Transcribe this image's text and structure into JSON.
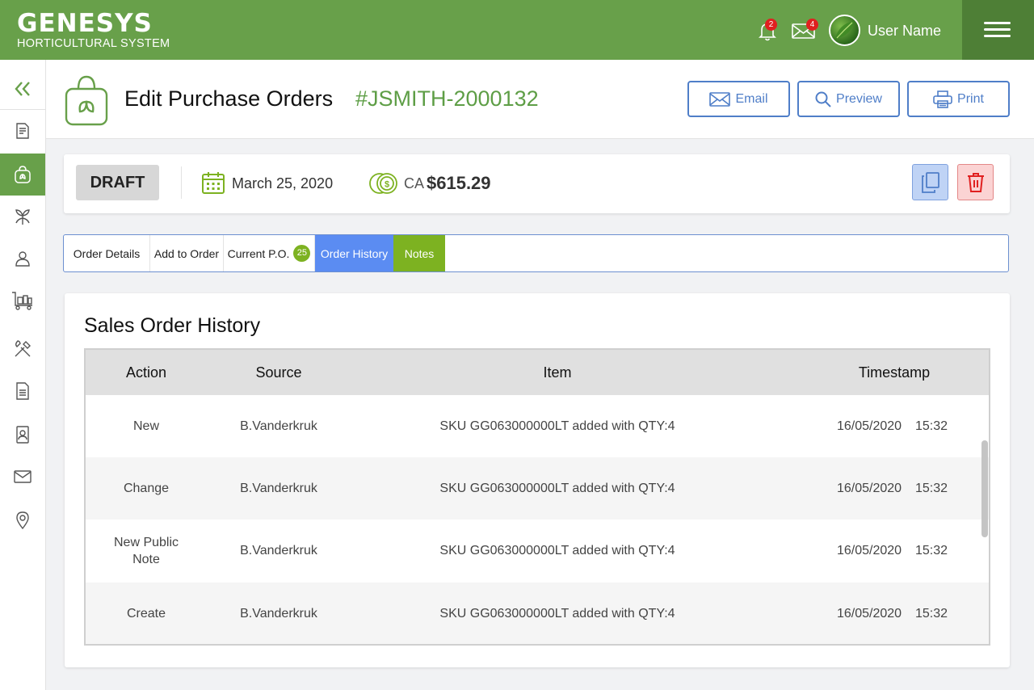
{
  "brand": {
    "name": "GENESYS",
    "subtitle": "HORTICULTURAL SYSTEM",
    "color": "#68a04a"
  },
  "topbar": {
    "notifications_count": "2",
    "messages_count": "4",
    "user_name": "User Name"
  },
  "sidebar": {
    "items": [
      {
        "icon": "collapse-icon"
      },
      {
        "icon": "document-list-icon"
      },
      {
        "icon": "purchase-bag-icon",
        "active": true
      },
      {
        "icon": "plant-icon"
      },
      {
        "icon": "contact-icon"
      },
      {
        "icon": "cart-icon"
      },
      {
        "icon": "tools-icon"
      },
      {
        "icon": "document-icon"
      },
      {
        "icon": "address-book-icon"
      },
      {
        "icon": "mail-icon"
      },
      {
        "icon": "location-icon"
      }
    ]
  },
  "header": {
    "title": "Edit Purchase Orders",
    "po_number": "#JSMITH-2000132",
    "buttons": {
      "email": "Email",
      "preview": "Preview",
      "print": "Print"
    }
  },
  "status": {
    "state": "DRAFT",
    "date": "March 25, 2020",
    "currency": "CA",
    "amount": "$615.29"
  },
  "tabs": [
    {
      "label": "Order Details"
    },
    {
      "label": "Add to Order"
    },
    {
      "label": "Current P.O.",
      "count": "25"
    },
    {
      "label": "Order History",
      "active": true
    },
    {
      "label": "Notes"
    }
  ],
  "history": {
    "title": "Sales Order History",
    "columns": [
      "Action",
      "Source",
      "Item",
      "Timestamp"
    ],
    "rows": [
      {
        "action": "New",
        "source": "B.Vanderkruk",
        "item": "SKU GG063000000LT added with QTY:4",
        "date": "16/05/2020",
        "time": "15:32"
      },
      {
        "action": "Change",
        "source": "B.Vanderkruk",
        "item": "SKU GG063000000LT added with QTY:4",
        "date": "16/05/2020",
        "time": "15:32"
      },
      {
        "action": "New Public Note",
        "source": "B.Vanderkruk",
        "item": "SKU GG063000000LT added with QTY:4",
        "date": "16/05/2020",
        "time": "15:32"
      },
      {
        "action": "Create",
        "source": "B.Vanderkruk",
        "item": "SKU GG063000000LT added with QTY:4",
        "date": "16/05/2020",
        "time": "15:32"
      }
    ]
  },
  "colors": {
    "primary_green": "#68a04a",
    "dark_green": "#4e7f36",
    "blue": "#4f7ec8",
    "active_tab": "#5b8cf2",
    "notes_tab": "#7db221",
    "badge_red": "#e02020"
  }
}
